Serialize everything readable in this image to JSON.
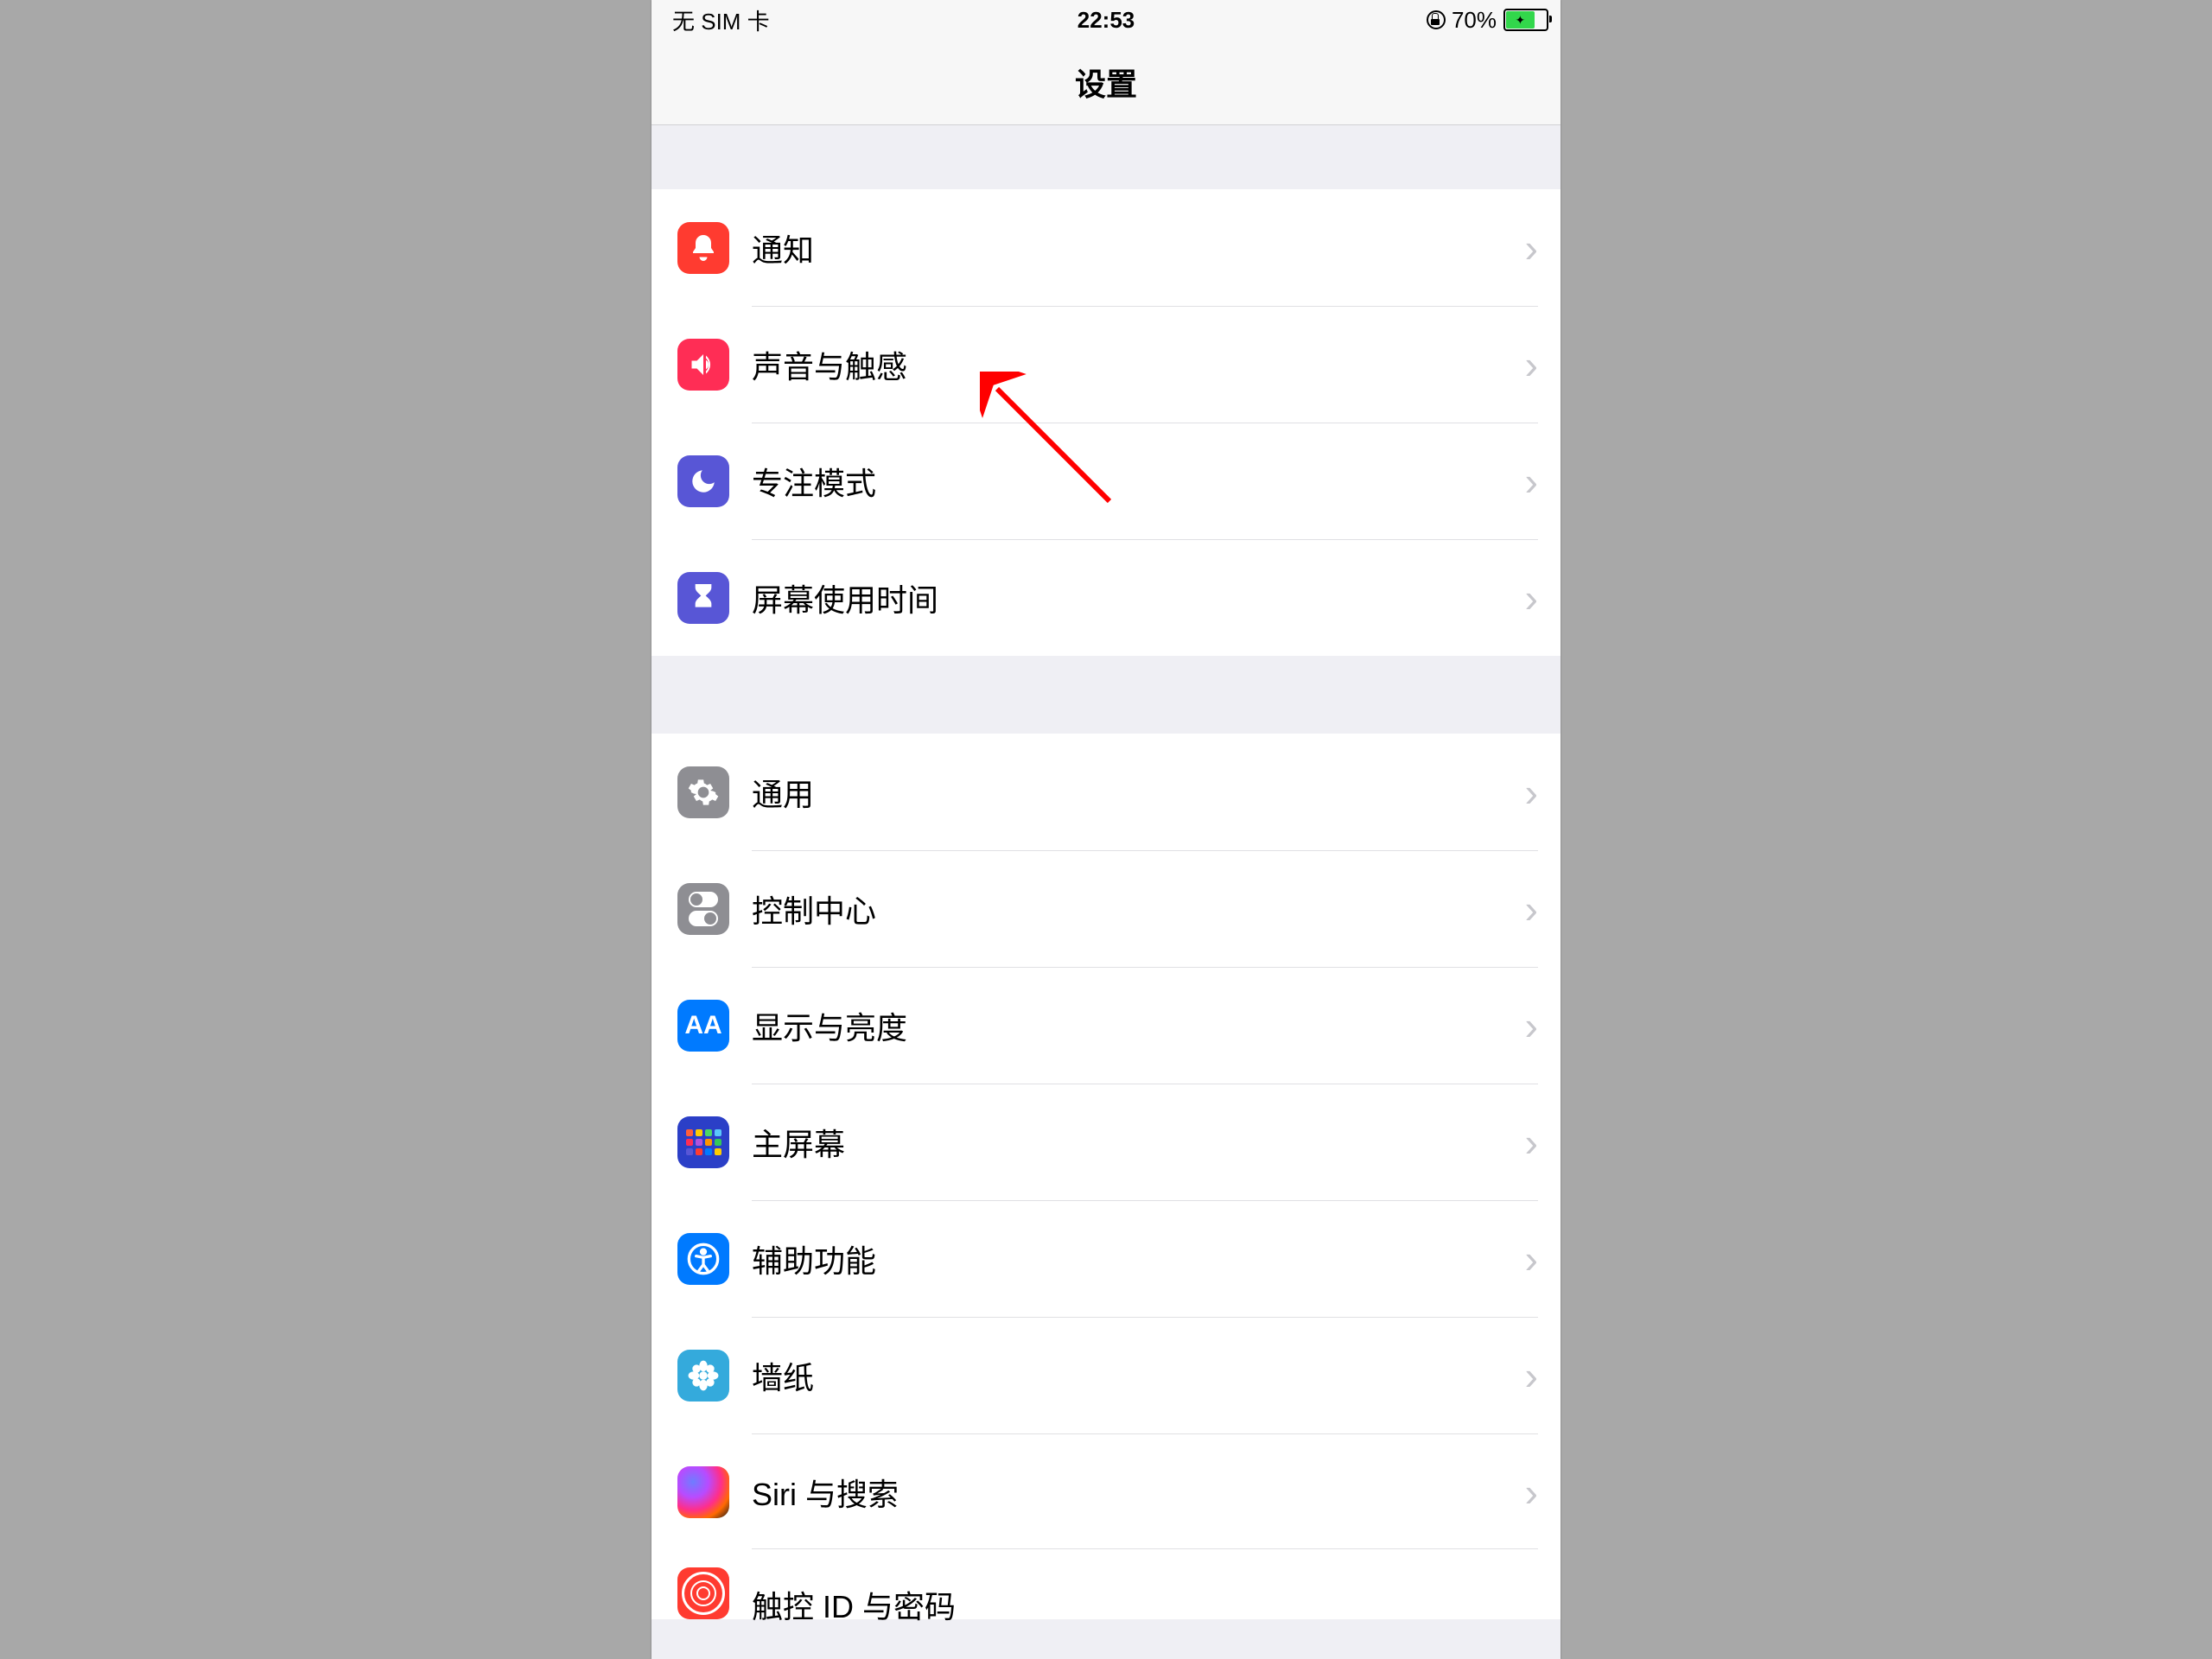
{
  "statusbar": {
    "carrier": "无 SIM 卡",
    "time": "22:53",
    "battery_pct": "70%"
  },
  "navbar": {
    "title": "设置"
  },
  "group1": {
    "items": [
      {
        "label": "通知",
        "icon": "bell-icon",
        "color": "#ff3b30"
      },
      {
        "label": "声音与触感",
        "icon": "speaker-icon",
        "color": "#ff2d55"
      },
      {
        "label": "专注模式",
        "icon": "moon-icon",
        "color": "#5856d6"
      },
      {
        "label": "屏幕使用时间",
        "icon": "hourglass-icon",
        "color": "#5856d6"
      }
    ]
  },
  "group2": {
    "items": [
      {
        "label": "通用",
        "icon": "gear-icon",
        "color": "#8e8e93"
      },
      {
        "label": "控制中心",
        "icon": "toggles-icon",
        "color": "#8e8e93"
      },
      {
        "label": "显示与亮度",
        "icon": "aa-icon",
        "color": "#007aff"
      },
      {
        "label": "主屏幕",
        "icon": "homegrid-icon",
        "color": "#3556c9"
      },
      {
        "label": "辅助功能",
        "icon": "accessibility-icon",
        "color": "#007aff"
      },
      {
        "label": "墙纸",
        "icon": "flower-icon",
        "color": "#38b5c9"
      },
      {
        "label": "Siri 与搜索",
        "icon": "siri-icon",
        "color": "#000000"
      },
      {
        "label": "触控 ID 与密码",
        "icon": "fingerprint-icon",
        "color": "#ff3b30"
      }
    ]
  },
  "annotation": {
    "target_item": "声音与触感"
  }
}
